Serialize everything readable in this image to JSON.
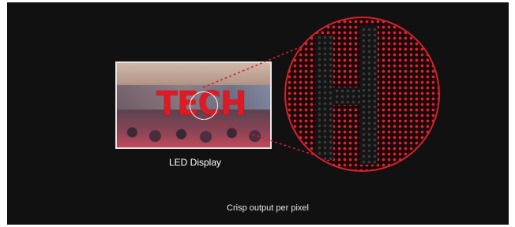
{
  "illustration": {
    "screen_text": "TECH",
    "display_label": "LED Display",
    "caption": "Crisp output per pixel"
  },
  "colors": {
    "background": "#111111",
    "led_red": "#e0222c",
    "ring_red": "#d4212b",
    "caption": "#e6e6e6"
  }
}
